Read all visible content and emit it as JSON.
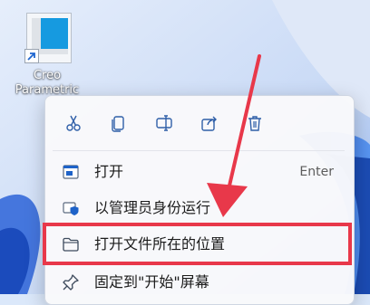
{
  "desktop": {
    "shortcut_label": "Creo\nParametric"
  },
  "context_menu": {
    "quick_actions": [
      {
        "name": "cut",
        "icon": "scissors-icon"
      },
      {
        "name": "copy",
        "icon": "copy-icon"
      },
      {
        "name": "rename",
        "icon": "rename-icon"
      },
      {
        "name": "share",
        "icon": "share-icon"
      },
      {
        "name": "delete",
        "icon": "trash-icon"
      }
    ],
    "items": [
      {
        "label": "打开",
        "shortcut": "Enter",
        "icon": "open-app-icon"
      },
      {
        "label": "以管理员身份运行",
        "icon": "admin-shield-icon"
      },
      {
        "label": "打开文件所在的位置",
        "icon": "folder-icon"
      },
      {
        "label": "固定到\"开始\"屏幕",
        "icon": "pin-icon"
      }
    ]
  },
  "colors": {
    "accent": "#0a6ed1",
    "annotation": "#e8384a"
  }
}
